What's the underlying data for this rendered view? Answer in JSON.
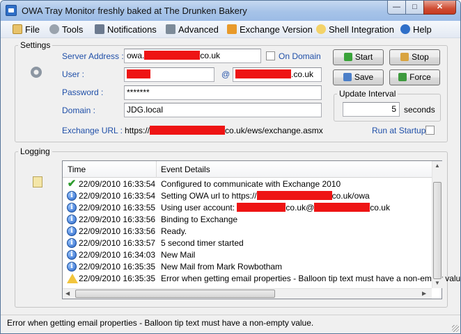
{
  "window": {
    "title": "OWA Tray Monitor freshly baked at The Drunken Bakery",
    "min_glyph": "—",
    "max_glyph": "□",
    "close_glyph": "✕"
  },
  "menu": {
    "file": "File",
    "tools": "Tools",
    "notifications": "Notifications",
    "advanced": "Advanced",
    "exchange_version": "Exchange Version",
    "shell_integration": "Shell Integration",
    "help": "Help"
  },
  "settings": {
    "group_label": "Settings",
    "server_address_label": "Server Address :",
    "server_address_prefix": "owa.",
    "server_address_suffix": "co.uk",
    "on_domain_label": "On Domain",
    "user_label": "User :",
    "at_symbol": "@",
    "user_domain_suffix": ".co.uk",
    "password_label": "Password :",
    "password_value": "*******",
    "domain_label": "Domain :",
    "domain_value": "JDG.local",
    "exchange_url_label": "Exchange URL :",
    "exchange_url_prefix": "https://",
    "exchange_url_suffix": "co.uk/ews/exchange.asmx",
    "run_at_startup_label": "Run at Startup",
    "update_interval_label": "Update Interval",
    "update_interval_value": "5",
    "update_interval_unit": "seconds",
    "start_button": "Start",
    "stop_button": "Stop",
    "save_button": "Save",
    "force_button": "Force"
  },
  "logging": {
    "group_label": "Logging",
    "columns": [
      "Time",
      "Event Details"
    ],
    "rows": [
      {
        "icon": "check",
        "time": "22/09/2010 16:33:54",
        "event": "Configured to communicate with Exchange 2010"
      },
      {
        "icon": "info",
        "time": "22/09/2010 16:33:54",
        "event": "Setting OWA url to https://",
        "event_suffix": "co.uk/owa"
      },
      {
        "icon": "info",
        "time": "22/09/2010 16:33:55",
        "event": "Using user account:",
        "event_suffix": "co.uk@",
        "event_suffix2": "co.uk"
      },
      {
        "icon": "info",
        "time": "22/09/2010 16:33:56",
        "event": "Binding to Exchange"
      },
      {
        "icon": "info",
        "time": "22/09/2010 16:33:56",
        "event": "Ready."
      },
      {
        "icon": "info",
        "time": "22/09/2010 16:33:57",
        "event": "5 second timer started"
      },
      {
        "icon": "info",
        "time": "22/09/2010 16:34:03",
        "event": "New Mail"
      },
      {
        "icon": "info",
        "time": "22/09/2010 16:35:35",
        "event": "New Mail from Mark Rowbotham"
      },
      {
        "icon": "warning",
        "time": "22/09/2010 16:35:35",
        "event": "Error when getting email properties - Balloon tip text must have a non-empty value."
      }
    ]
  },
  "status": {
    "text": "Error when getting email properties - Balloon tip text must have a non-empty value."
  },
  "colors": {
    "label_blue": "#1f4fa8",
    "redaction_red": "#ee1414",
    "title_gradient": "#a6c3e8"
  }
}
